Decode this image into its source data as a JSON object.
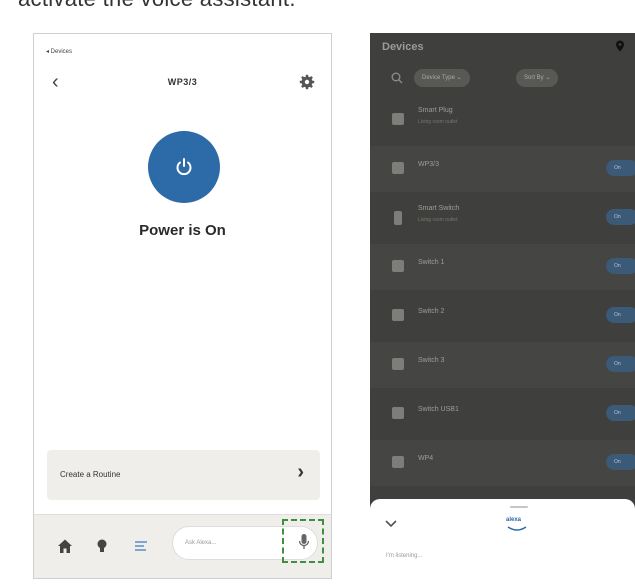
{
  "caption": "activate the voice assistant.",
  "left_screen": {
    "back_link": "◂ Devices",
    "device_name": "WP3/3",
    "power_status": "Power is On",
    "routine_label": "Create a Routine",
    "ask_placeholder": "Ask Alexa..."
  },
  "right_screen": {
    "title": "Devices",
    "filter_type": "Device Type ⌄",
    "filter_sort": "Sort By ⌄",
    "devices": [
      {
        "name": "Smart Plug",
        "sub": "Living room outlet",
        "toggle": ""
      },
      {
        "name": "WP3/3",
        "sub": "",
        "toggle": "On"
      },
      {
        "name": "Smart Switch",
        "sub": "Living room outlet",
        "toggle": "On"
      },
      {
        "name": "Switch 1",
        "sub": "",
        "toggle": "On"
      },
      {
        "name": "Switch 2",
        "sub": "",
        "toggle": "On"
      },
      {
        "name": "Switch 3",
        "sub": "",
        "toggle": "On"
      },
      {
        "name": "Switch USB1",
        "sub": "",
        "toggle": "On"
      },
      {
        "name": "WP4",
        "sub": "",
        "toggle": "On"
      }
    ],
    "sheet": {
      "assistant_name": "alexa",
      "status": "I'm listening..."
    }
  },
  "colors": {
    "power_blue": "#2d6aa8",
    "highlight_green": "#3f8f3f",
    "dark_bg": "#3f3f3d"
  }
}
